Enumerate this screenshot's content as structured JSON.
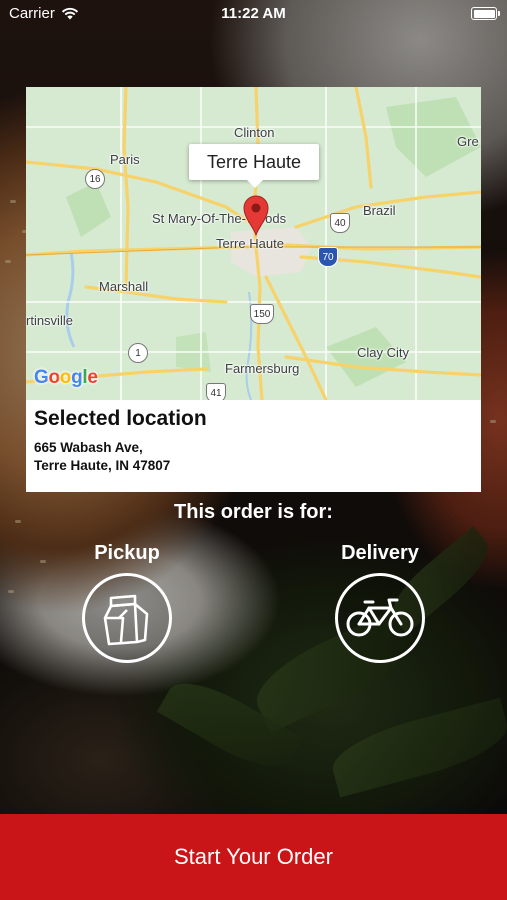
{
  "status_bar": {
    "carrier": "Carrier",
    "time": "11:22 AM"
  },
  "map": {
    "tooltip": "Terre Haute",
    "labels": {
      "clinton": "Clinton",
      "paris": "Paris",
      "gre": "Gre",
      "brazil": "Brazil",
      "st_mary": "St Mary-Of-The-Woods",
      "terre_haute": "Terre Haute",
      "marshall": "Marshall",
      "martinsville": "rtinsville",
      "clay_city": "Clay City",
      "farmersburg": "Farmersburg"
    },
    "shields": {
      "r16": "16",
      "r40": "40",
      "i70": "70",
      "r150": "150",
      "r1": "1",
      "r41": "41"
    },
    "google": [
      "G",
      "o",
      "o",
      "g",
      "l",
      "e"
    ]
  },
  "location": {
    "title": "Selected location",
    "address_line1": "665 Wabash Ave,",
    "address_line2": "Terre Haute, IN 47807"
  },
  "order": {
    "prompt": "This order is for:",
    "pickup_label": "Pickup",
    "delivery_label": "Delivery",
    "pickup_icon": "shopping-bag-icon",
    "delivery_icon": "bicycle-icon"
  },
  "cta": {
    "label": "Start Your Order",
    "color": "#c91517"
  }
}
